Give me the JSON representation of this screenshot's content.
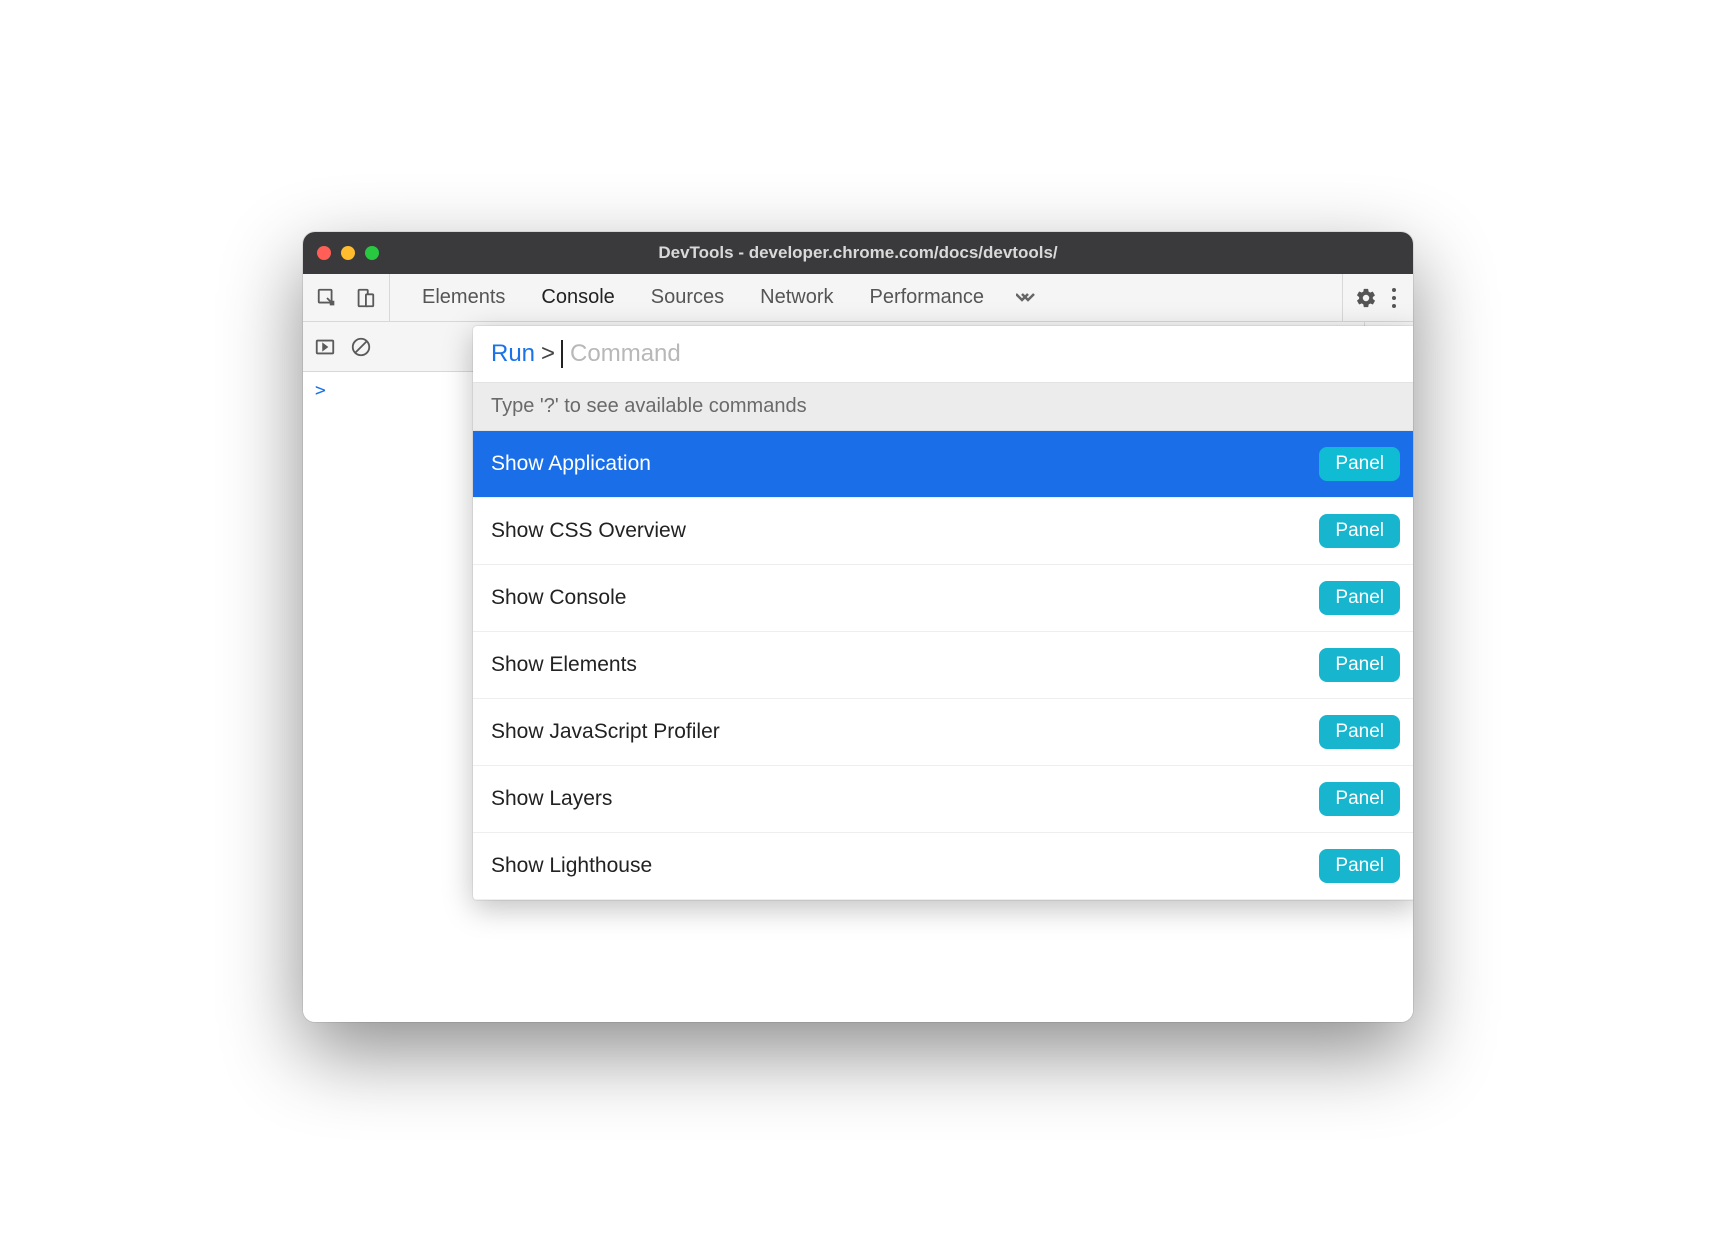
{
  "window": {
    "title": "DevTools - developer.chrome.com/docs/devtools/"
  },
  "toolbar": {
    "tabs": [
      "Elements",
      "Console",
      "Sources",
      "Network",
      "Performance"
    ],
    "active_tab": "Console"
  },
  "console": {
    "prompt_symbol": ">"
  },
  "command_menu": {
    "run_label": "Run",
    "caret": ">",
    "placeholder": "Command",
    "hint": "Type '?' to see available commands",
    "badge_label": "Panel",
    "items": [
      {
        "label": "Show Application",
        "selected": true
      },
      {
        "label": "Show CSS Overview",
        "selected": false
      },
      {
        "label": "Show Console",
        "selected": false
      },
      {
        "label": "Show Elements",
        "selected": false
      },
      {
        "label": "Show JavaScript Profiler",
        "selected": false
      },
      {
        "label": "Show Layers",
        "selected": false
      },
      {
        "label": "Show Lighthouse",
        "selected": false
      }
    ]
  }
}
